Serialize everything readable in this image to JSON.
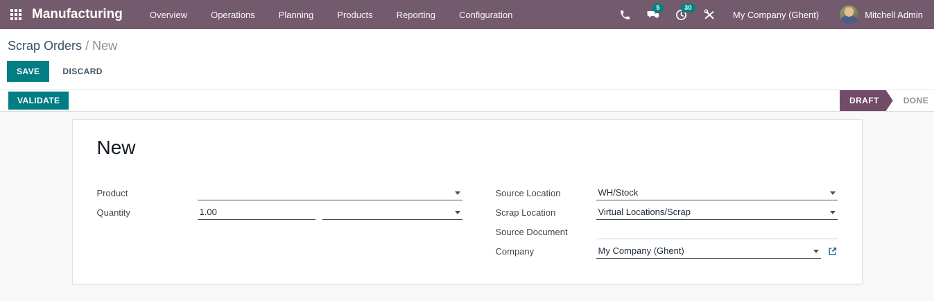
{
  "header": {
    "app_name": "Manufacturing",
    "menu": [
      "Overview",
      "Operations",
      "Planning",
      "Products",
      "Reporting",
      "Configuration"
    ],
    "messages_badge": "5",
    "activities_badge": "30",
    "company": "My Company (Ghent)",
    "user": "Mitchell Admin"
  },
  "breadcrumb": {
    "parent": "Scrap Orders",
    "separator": "/",
    "current": "New"
  },
  "actions": {
    "save": "SAVE",
    "discard": "DISCARD"
  },
  "statusbar": {
    "validate": "VALIDATE",
    "states": [
      {
        "label": "DRAFT",
        "active": true
      },
      {
        "label": "DONE",
        "active": false
      }
    ]
  },
  "form": {
    "title": "New",
    "fields": {
      "product": {
        "label": "Product",
        "value": ""
      },
      "quantity": {
        "label": "Quantity",
        "value": "1.00",
        "uom": ""
      },
      "source_location": {
        "label": "Source Location",
        "value": "WH/Stock"
      },
      "scrap_location": {
        "label": "Scrap Location",
        "value": "Virtual Locations/Scrap"
      },
      "source_document": {
        "label": "Source Document",
        "value": ""
      },
      "company": {
        "label": "Company",
        "value": "My Company (Ghent)"
      }
    }
  },
  "colors": {
    "header_bg": "#745a6d",
    "primary_teal": "#017e84",
    "badge_teal": "#00837c",
    "state_active_bg": "#714b67",
    "breadcrumb_link": "#374e66",
    "external_link_icon": "#2d6e8f"
  }
}
